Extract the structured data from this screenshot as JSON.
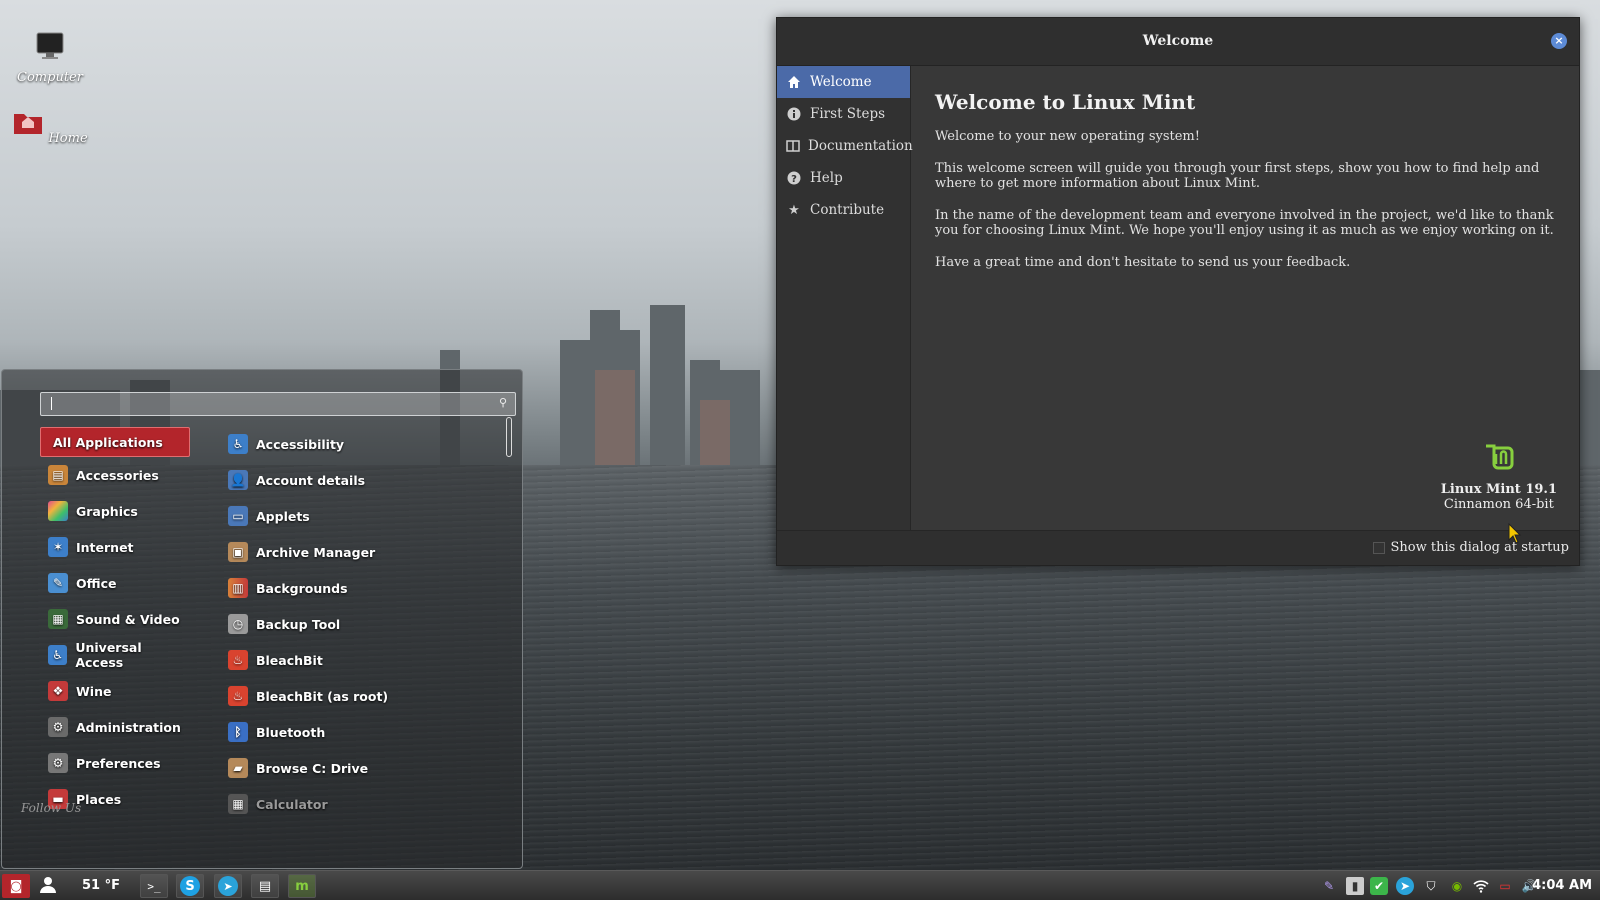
{
  "desktop": {
    "icons": [
      {
        "label": "Computer",
        "icon": "computer-icon"
      },
      {
        "label": "Home",
        "icon": "home-folder-icon"
      }
    ]
  },
  "welcome_window": {
    "title": "Welcome",
    "sidebar": [
      {
        "label": "Welcome",
        "icon": "home-icon",
        "active": true
      },
      {
        "label": "First Steps",
        "icon": "info-icon"
      },
      {
        "label": "Documentation",
        "icon": "book-icon"
      },
      {
        "label": "Help",
        "icon": "help-icon"
      },
      {
        "label": "Contribute",
        "icon": "star-icon"
      }
    ],
    "heading": "Welcome to Linux Mint",
    "paragraphs": [
      "Welcome to your new operating system!",
      "This welcome screen will guide you through your first steps, show you how to find help and where to get more information about Linux Mint.",
      "In the name of the development team and everyone involved in the project, we'd like to thank you for choosing Linux Mint. We hope you'll enjoy using it as much as we enjoy working on it.",
      "Have a great time and don't hesitate to send us your feedback."
    ],
    "version": "Linux Mint 19.1",
    "edition": "Cinnamon 64-bit",
    "startup_checkbox": {
      "label": "Show this dialog at startup",
      "checked": false
    }
  },
  "menu": {
    "search": {
      "value": "",
      "placeholder": ""
    },
    "categories": [
      {
        "label": "All Applications",
        "active": true
      },
      {
        "label": "Accessories",
        "icon": "accessories-icon",
        "color": "#c9853a"
      },
      {
        "label": "Graphics",
        "icon": "graphics-icon",
        "color": "#e04a8f"
      },
      {
        "label": "Internet",
        "icon": "internet-icon",
        "color": "#3d7fc9"
      },
      {
        "label": "Office",
        "icon": "office-icon",
        "color": "#4a8fd1"
      },
      {
        "label": "Sound & Video",
        "icon": "sound-video-icon",
        "color": "#3a6a3a"
      },
      {
        "label": "Universal Access",
        "icon": "accessibility-icon",
        "color": "#3d7fc9"
      },
      {
        "label": "Wine",
        "icon": "wine-icon",
        "color": "#c43a3a"
      },
      {
        "label": "Administration",
        "icon": "administration-icon",
        "color": "#6a6a6a"
      },
      {
        "label": "Preferences",
        "icon": "preferences-icon",
        "color": "#777777"
      },
      {
        "label": "Places",
        "icon": "folder-icon",
        "color": "#c43a3a"
      }
    ],
    "applications": [
      {
        "label": "Accessibility",
        "icon": "accessibility-icon",
        "color": "#3d7fc9"
      },
      {
        "label": "Account details",
        "icon": "account-icon",
        "color": "#4a78b8"
      },
      {
        "label": "Applets",
        "icon": "applets-icon",
        "color": "#4a78b8"
      },
      {
        "label": "Archive Manager",
        "icon": "archive-icon",
        "color": "#b5895a"
      },
      {
        "label": "Backgrounds",
        "icon": "backgrounds-icon",
        "color": "#d8813a"
      },
      {
        "label": "Backup Tool",
        "icon": "backup-icon",
        "color": "#9a9a9a"
      },
      {
        "label": "BleachBit",
        "icon": "bleachbit-icon",
        "color": "#d9432f"
      },
      {
        "label": "BleachBit (as root)",
        "icon": "bleachbit-root-icon",
        "color": "#d9432f"
      },
      {
        "label": "Bluetooth",
        "icon": "bluetooth-icon",
        "color": "#3a6fc4"
      },
      {
        "label": "Browse C: Drive",
        "icon": "drive-icon",
        "color": "#b5895a"
      },
      {
        "label": "Calculator",
        "icon": "calculator-icon",
        "color": "#6a6a6a",
        "dim": true
      }
    ],
    "follow_text": "Follow Us"
  },
  "panel": {
    "weather": "51 °F",
    "clock": "4:04 AM"
  }
}
